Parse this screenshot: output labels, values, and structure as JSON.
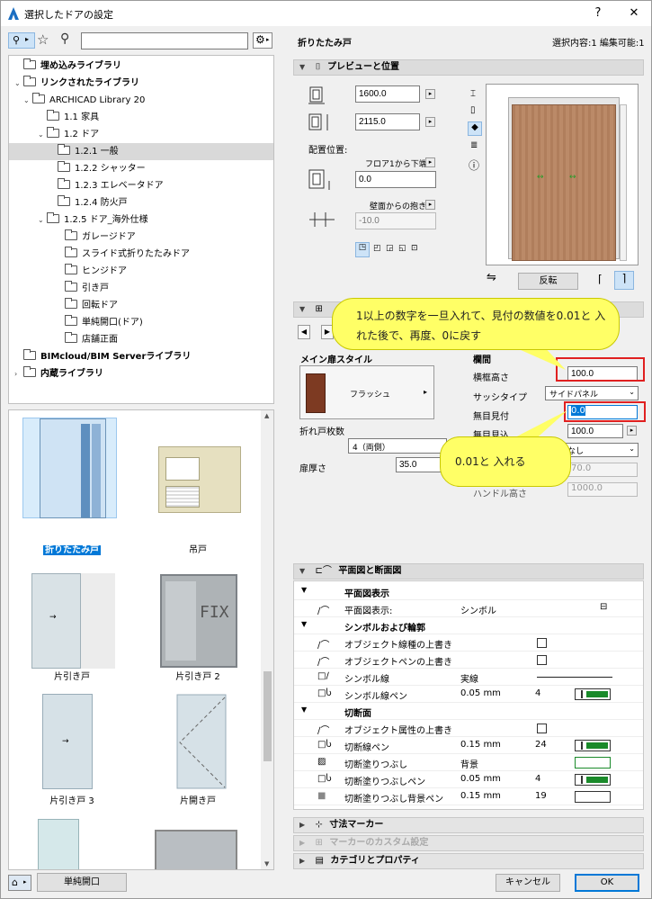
{
  "window": {
    "title": "選択したドアの設定",
    "help": "?",
    "close": "✕"
  },
  "left": {
    "search_placeholder": "",
    "tree": [
      {
        "label": "埋め込みライブラリ",
        "bold": true,
        "expander": "",
        "indent": 0
      },
      {
        "label": "リンクされたライブラリ",
        "bold": true,
        "expander": "⌄",
        "indent": 0
      },
      {
        "label": "ARCHICAD Library 20",
        "bold": false,
        "expander": "⌄",
        "indent": 1
      },
      {
        "label": "1.1 家具",
        "bold": false,
        "expander": "",
        "indent": 2
      },
      {
        "label": "1.2 ドア",
        "bold": false,
        "expander": "⌄",
        "indent": 2
      },
      {
        "label": "1.2.1 一般",
        "bold": false,
        "expander": "",
        "indent": 3,
        "selected": true
      },
      {
        "label": "1.2.2 シャッター",
        "bold": false,
        "expander": "",
        "indent": 3
      },
      {
        "label": "1.2.3 エレベータドア",
        "bold": false,
        "expander": "",
        "indent": 3
      },
      {
        "label": "1.2.4 防火戸",
        "bold": false,
        "expander": "",
        "indent": 3
      },
      {
        "label": "1.2.5 ドア_海外仕様",
        "bold": false,
        "expander": "⌄",
        "indent": 3
      },
      {
        "label": "ガレージドア",
        "bold": false,
        "expander": "",
        "indent": 4
      },
      {
        "label": "スライド式折りたたみドア",
        "bold": false,
        "expander": "",
        "indent": 4
      },
      {
        "label": "ヒンジドア",
        "bold": false,
        "expander": "",
        "indent": 4
      },
      {
        "label": "引き戸",
        "bold": false,
        "expander": "",
        "indent": 4
      },
      {
        "label": "回転ドア",
        "bold": false,
        "expander": "",
        "indent": 4
      },
      {
        "label": "単純開口(ドア)",
        "bold": false,
        "expander": "",
        "indent": 4
      },
      {
        "label": "店舗正面",
        "bold": false,
        "expander": "",
        "indent": 4
      },
      {
        "label": "BIMcloud/BIM Serverライブラリ",
        "bold": true,
        "expander": "",
        "indent": 0
      },
      {
        "label": "内蔵ライブラリ",
        "bold": true,
        "expander": "›",
        "indent": 0
      }
    ],
    "thumbnails": [
      {
        "label": "折りたたみ戸",
        "selected": true
      },
      {
        "label": "吊戸",
        "selected": false
      },
      {
        "label": "片引き戸",
        "selected": false
      },
      {
        "label": "片引き戸 2",
        "selected": false
      },
      {
        "label": "片引き戸 3",
        "selected": false
      },
      {
        "label": "片開き戸",
        "selected": false
      }
    ],
    "fix_text": "FIX",
    "bottom_button": "単純開口"
  },
  "right": {
    "object_name": "折りたたみ戸",
    "selection_info": "選択内容:1 編集可能:1",
    "preview_section": {
      "title": "プレビューと位置",
      "width": "1600.0",
      "height": "2115.0",
      "placement_label": "配置位置:",
      "floor_ref": "フロア1から下端",
      "sill": "0.0",
      "wall_ref": "壁面からの抱き",
      "reveal": "-10.0",
      "flip_button": "反転"
    },
    "panel_section": {
      "main_style_label": "メイン扉スタイル",
      "style_name": "フラッシュ",
      "leaf_count_label": "折れ戸枚数",
      "leaf_count": "4（両側）",
      "thickness_label": "扉厚さ",
      "thickness": "35.0",
      "frame_header": "欄間",
      "frame_height_label": "横框高さ",
      "frame_height": "100.0",
      "sash_type_label": "サッシタイプ",
      "sash_type": "サイドパネル",
      "mullion_label": "無目見付",
      "mullion_value": "0.0",
      "mullion_depth_label": "無目見込",
      "mullion_depth": "100.0",
      "none_option": "なし",
      "grey_value_1": "70.0",
      "grey_value_2": "1000.0",
      "handle_height_label": "ハンドル高さ"
    },
    "callouts": {
      "top": "1以上の数字を一旦入れて、見付の数値を0.01と 入れた後で、再度、0に戻す",
      "bottom": "0.01と 入れる"
    },
    "plan_section": {
      "title": "平面図と断面図",
      "rows": [
        {
          "type": "group",
          "label": "平面図表示"
        },
        {
          "type": "row",
          "label": "平面図表示:",
          "value": "シンボル",
          "extra": "",
          "icon": ""
        },
        {
          "type": "group",
          "label": "シンボルおよび輪郭"
        },
        {
          "type": "row",
          "label": "オブジェクト線種の上書き",
          "value": "",
          "extra": "",
          "icon": "check"
        },
        {
          "type": "row",
          "label": "オブジェクトペンの上書き",
          "value": "",
          "extra": "",
          "icon": "check"
        },
        {
          "type": "row",
          "label": "シンボル線",
          "value": "実線",
          "extra": "",
          "icon": "line"
        },
        {
          "type": "row",
          "label": "シンボル線ペン",
          "value": "0.05 mm",
          "extra": "4",
          "icon": "pen"
        },
        {
          "type": "group",
          "label": "切断面"
        },
        {
          "type": "row",
          "label": "オブジェクト属性の上書き",
          "value": "",
          "extra": "",
          "icon": "check"
        },
        {
          "type": "row",
          "label": "切断線ペン",
          "value": "0.15 mm",
          "extra": "24",
          "icon": "pen"
        },
        {
          "type": "row",
          "label": "切断塗りつぶし",
          "value": "背景",
          "extra": "",
          "icon": "fill"
        },
        {
          "type": "row",
          "label": "切断塗りつぶしペン",
          "value": "0.05 mm",
          "extra": "4",
          "icon": "pen"
        },
        {
          "type": "row",
          "label": "切断塗りつぶし背景ペン",
          "value": "0.15 mm",
          "extra": "19",
          "icon": "blank"
        }
      ]
    },
    "collapsed_sections": [
      {
        "title": "寸法マーカー",
        "disabled": false
      },
      {
        "title": "マーカーのカスタム設定",
        "disabled": true
      },
      {
        "title": "カテゴリとプロパティ",
        "disabled": false
      }
    ],
    "cancel_button": "キャンセル",
    "ok_button": "OK"
  },
  "colors": {
    "accent": "#0078d7",
    "pen_green": "#1a8a2a",
    "callout": "#ffff66",
    "highlight": "#e02020"
  }
}
